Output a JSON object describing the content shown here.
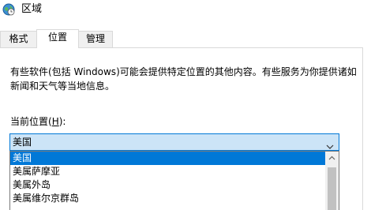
{
  "window": {
    "title": "区域",
    "title_icon": "globe-clock-icon"
  },
  "tabs": [
    {
      "label": "格式",
      "active": false
    },
    {
      "label": "位置",
      "active": true
    },
    {
      "label": "管理",
      "active": false
    }
  ],
  "location": {
    "description": "有些软件(包括 Windows)可能会提供特定位置的其他内容。有些服务为你提供诸如新闻和天气等当地信息。",
    "field_label_prefix": "当前位置(",
    "field_label_hotkey": "H",
    "field_label_suffix": "):",
    "selected_value": "美国",
    "dropdown_arrow_icon": "chevron-down-icon",
    "options": [
      "美国",
      "美属萨摩亚",
      "美属外岛",
      "美属维尔京群岛"
    ]
  },
  "colors": {
    "accent": "#0078d7",
    "combo_background": "#cce4f7"
  }
}
